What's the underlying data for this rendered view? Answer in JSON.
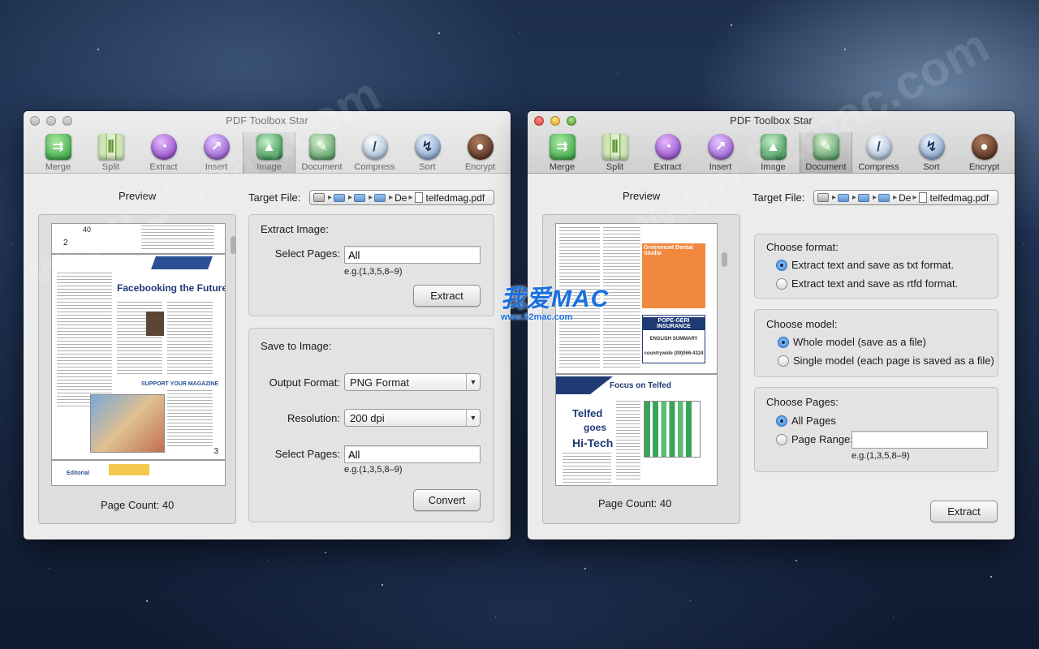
{
  "windows": {
    "left": {
      "title": "PDF Toolbox Star",
      "selected_tool": "Image",
      "tools": [
        "Merge",
        "Split",
        "Extract",
        "Insert",
        "Image",
        "Document",
        "Compress",
        "Sort",
        "Encrypt"
      ],
      "preview_label": "Preview",
      "page_count": "Page Count: 40",
      "target_label": "Target File:",
      "target_path": {
        "crumb_abbrev": "De",
        "file": "telfedmag.pdf"
      },
      "extract_image": {
        "title": "Extract Image:",
        "select_pages_label": "Select Pages:",
        "select_pages_value": "All",
        "hint": "e.g.(1,3,5,8–9)",
        "button": "Extract"
      },
      "save_to_image": {
        "title": "Save to Image:",
        "format_label": "Output Format:",
        "format_value": "PNG Format",
        "resolution_label": "Resolution:",
        "resolution_value": "200 dpi",
        "select_pages_label": "Select Pages:",
        "select_pages_value": "All",
        "hint": "e.g.(1,3,5,8–9)",
        "button": "Convert"
      },
      "pdf_text": {
        "page_num_top": "40",
        "page_num_2": "2",
        "headline": "Facebooking the Future",
        "section": "SUPPORT YOUR MAGAZINE",
        "page_num_3": "3",
        "badge": "Editorial"
      }
    },
    "right": {
      "title": "PDF Toolbox Star",
      "selected_tool": "Document",
      "tools": [
        "Merge",
        "Split",
        "Extract",
        "Insert",
        "Image",
        "Document",
        "Compress",
        "Sort",
        "Encrypt"
      ],
      "preview_label": "Preview",
      "page_count": "Page Count: 40",
      "target_label": "Target File:",
      "target_path": {
        "crumb_abbrev": "De",
        "file": "telfedmag.pdf"
      },
      "choose_format": {
        "title": "Choose format:",
        "options": [
          "Extract text and save as txt format.",
          "Extract text and save as rtfd format."
        ],
        "selected": 0
      },
      "choose_model": {
        "title": "Choose model:",
        "options": [
          "Whole model (save as a file)",
          "Single model (each page is saved as a file)"
        ],
        "selected": 0
      },
      "choose_pages": {
        "title": "Choose Pages:",
        "options": [
          "All Pages",
          "Page Range:"
        ],
        "selected": 0,
        "range_value": "",
        "hint": "e.g.(1,3,5,8–9)"
      },
      "button": "Extract",
      "pdf_text": {
        "ad_title": "Greenmont Dental Studio",
        "ad2_title": "POPE-GERI INSURANCE",
        "ad2_sub": "ENGLISH SUMMARY",
        "ad2_phone": "countrywide (09)066-4324",
        "focus": "Focus on Telfed",
        "telfed": "Telfed",
        "goes": "goes",
        "hitech": "Hi-Tech"
      }
    }
  },
  "overlay": {
    "brand_big": "我爱MAC",
    "brand_small": "www.52mac.com",
    "watermark": "www.52mac.com"
  },
  "colors": {
    "window_bg": "#ececec",
    "radio_selected": "#2d7fde",
    "brand_blue": "#1a6fe0"
  }
}
